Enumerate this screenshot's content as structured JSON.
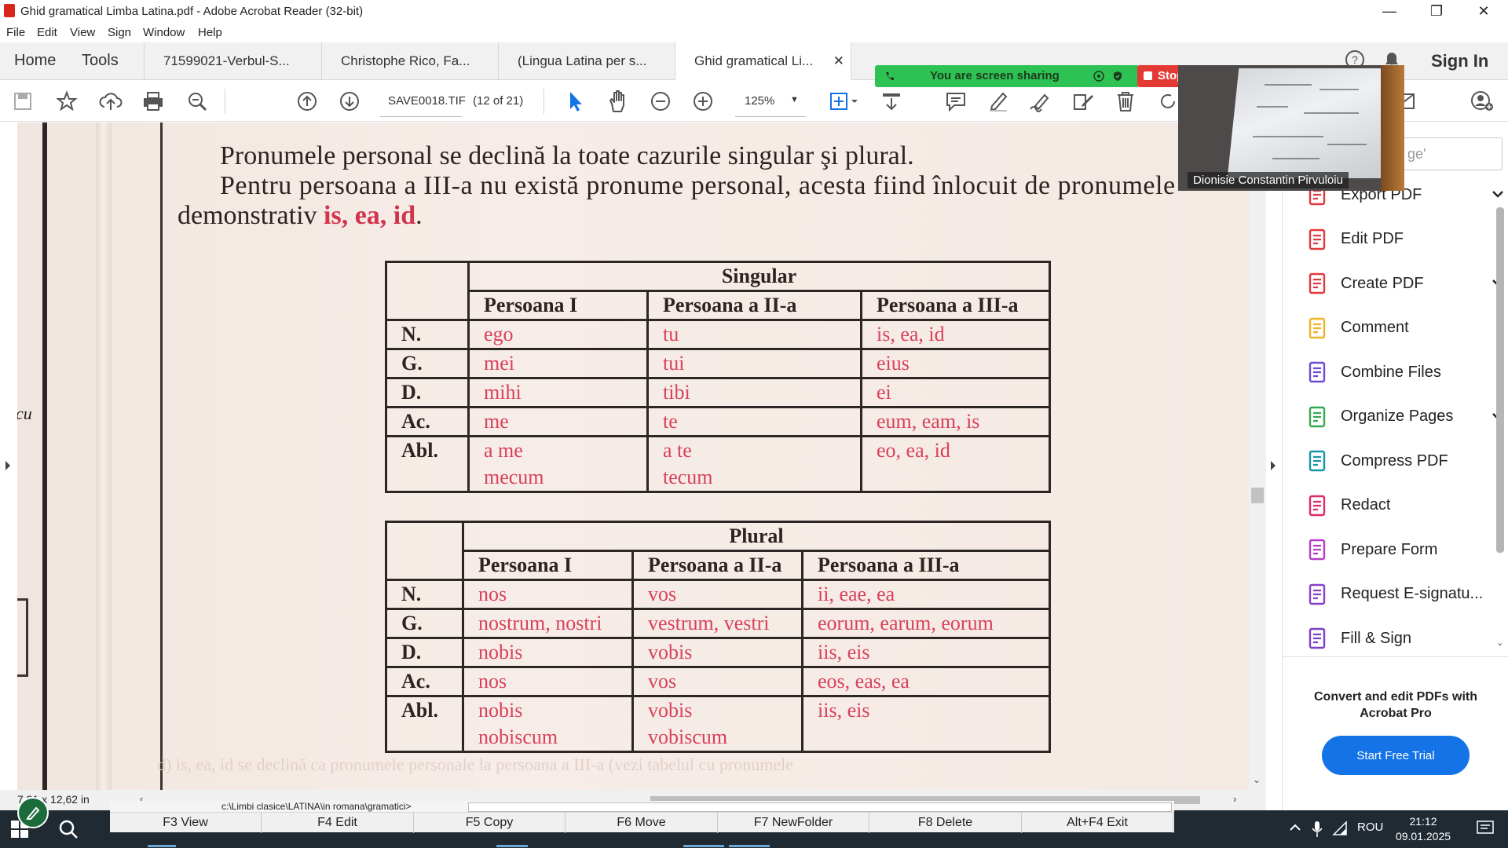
{
  "window": {
    "title": "Ghid gramatical Limba Latina.pdf - Adobe Acrobat Reader (32-bit)"
  },
  "menu": [
    "File",
    "Edit",
    "View",
    "Sign",
    "Window",
    "Help"
  ],
  "nav": {
    "home": "Home",
    "tools": "Tools",
    "signin": "Sign In"
  },
  "tabs": [
    {
      "label": "71599021-Verbul-S..."
    },
    {
      "label": "Christophe Rico, Fa..."
    },
    {
      "label": "(Lingua Latina per s..."
    },
    {
      "label": "Ghid gramatical Li...",
      "active": true
    }
  ],
  "toolbar": {
    "filename": "SAVE0018.TIF",
    "page": "(12 of 21)",
    "zoom": "125%"
  },
  "share": {
    "banner": "You are screen sharing",
    "stop": "Stop share",
    "webcam_name": "Dionisie Constantin Pirvuloiu"
  },
  "document": {
    "margin_text": "cu",
    "para1": "Pronumele personal se declină la toate cazurile singular şi plural.",
    "para2": "Pentru persoana a III-a nu există pronume personal, acesta fiind înlocuit de pronumele",
    "para3_prefix": "demonstrativ ",
    "para3_red": "is, ea, id",
    "para3_suffix": ".",
    "bottom_ghost": "d) is, ea, id se declină ca pronumele personale la persoana a III-a (vezi tabelul cu pronumele"
  },
  "singular": {
    "title": "Singular",
    "headers": [
      "Persoana I",
      "Persoana a II-a",
      "Persoana a III-a"
    ],
    "rows": [
      {
        "case": "N.",
        "p1": "ego",
        "p2": "tu",
        "p3": "is, ea, id"
      },
      {
        "case": "G.",
        "p1": "mei",
        "p2": "tui",
        "p3": "eius"
      },
      {
        "case": "D.",
        "p1": "mihi",
        "p2": "tibi",
        "p3": "ei"
      },
      {
        "case": "Ac.",
        "p1": "me",
        "p2": "te",
        "p3": "eum, eam, is"
      },
      {
        "case": "Abl.",
        "p1": "a me",
        "p1b": "mecum",
        "p2": "a te",
        "p2b": "tecum",
        "p3": "eo, ea, id"
      }
    ]
  },
  "plural": {
    "title": "Plural",
    "headers": [
      "Persoana I",
      "Persoana a II-a",
      "Persoana a III-a"
    ],
    "rows": [
      {
        "case": "N.",
        "p1": "nos",
        "p2": "vos",
        "p3": "ii, eae, ea"
      },
      {
        "case": "G.",
        "p1": "nostrum, nostri",
        "p2": "vestrum, vestri",
        "p3": "eorum, earum, eorum"
      },
      {
        "case": "D.",
        "p1": "nobis",
        "p2": "vobis",
        "p3": "iis, eis"
      },
      {
        "case": "Ac.",
        "p1": "nos",
        "p2": "vos",
        "p3": "eos, eas, ea"
      },
      {
        "case": "Abl.",
        "p1": "nobis",
        "p1b": "nobiscum",
        "p2": "vobis",
        "p2b": "vobiscum",
        "p3": "iis, eis"
      }
    ]
  },
  "status": {
    "dimensions": "7,21 x 12,62 in",
    "path": "c:\\Limbi clasice\\LATINA\\in romana\\gramatici>"
  },
  "panel": {
    "search_placeholder": "ge'",
    "items": [
      {
        "label": "Export PDF",
        "chevron": true,
        "icon": "export-pdf-icon",
        "color": "#e0393e"
      },
      {
        "label": "Edit PDF",
        "chevron": false,
        "icon": "edit-pdf-icon",
        "color": "#e0393e"
      },
      {
        "label": "Create PDF",
        "chevron": true,
        "icon": "create-pdf-icon",
        "color": "#e0393e"
      },
      {
        "label": "Comment",
        "chevron": false,
        "icon": "comment-icon",
        "color": "#f0b323"
      },
      {
        "label": "Combine Files",
        "chevron": false,
        "icon": "combine-files-icon",
        "color": "#6d4ad1"
      },
      {
        "label": "Organize Pages",
        "chevron": true,
        "icon": "organize-pages-icon",
        "color": "#36a852"
      },
      {
        "label": "Compress PDF",
        "chevron": false,
        "icon": "compress-pdf-icon",
        "color": "#1596a6"
      },
      {
        "label": "Redact",
        "chevron": false,
        "icon": "redact-icon",
        "color": "#e0286a"
      },
      {
        "label": "Prepare Form",
        "chevron": false,
        "icon": "prepare-form-icon",
        "color": "#b53fc5"
      },
      {
        "label": "Request E-signatu...",
        "chevron": false,
        "icon": "request-esign-icon",
        "color": "#8a3fc5"
      },
      {
        "label": "Fill & Sign",
        "chevron": false,
        "icon": "fill-sign-icon",
        "color": "#7a3fc5"
      }
    ],
    "promo": "Convert and edit PDFs with Acrobat Pro",
    "trial": "Start Free Trial"
  },
  "fkeys": [
    "F3 View",
    "F4 Edit",
    "F5 Copy",
    "F6 Move",
    "F7 NewFolder",
    "F8 Delete",
    "Alt+F4 Exit"
  ],
  "tray": {
    "lang": "ROU",
    "time": "21:12",
    "date": "09.01.2025"
  }
}
